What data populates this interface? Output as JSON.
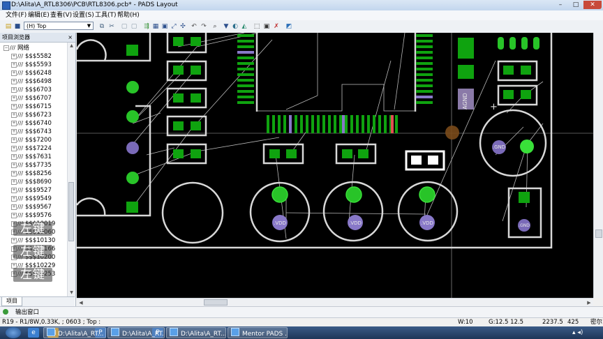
{
  "window": {
    "title": "D:\\Alita\\A_RTL8306\\PCB\\RTL8306.pcb* - PADS Layout",
    "min": "–",
    "max": "□",
    "close": "✕"
  },
  "menu": [
    "文件(F)",
    "编辑(E)",
    "查看(V)",
    "设置(S)",
    "工具(T)",
    "帮助(H)"
  ],
  "toolbar": {
    "layer_select": "(H) Top",
    "icons": [
      "open-icon",
      "save-icon",
      "layer-select",
      "copy-icon",
      "cut-icon",
      "paste-icon",
      "route-icon",
      "drc-icon",
      "measure-icon",
      "undo-icon",
      "redo-icon",
      "zoom-icon",
      "filter-icon",
      "color-icon",
      "highlight-icon",
      "select-icon",
      "net-icon",
      "help-icon"
    ]
  },
  "panel": {
    "title": "项目浏览器",
    "close": "×",
    "root_label": "网络",
    "nets": [
      "$$$5582",
      "$$$5593",
      "$$$6248",
      "$$$6498",
      "$$$6703",
      "$$$6707",
      "$$$6715",
      "$$$6723",
      "$$$6740",
      "$$$6743",
      "$$$7200",
      "$$$7224",
      "$$$7631",
      "$$$7735",
      "$$$8256",
      "$$$8690",
      "$$$9527",
      "$$$9549",
      "$$$9567",
      "$$$9576",
      "$$$10019",
      "$$$10060",
      "$$$10130",
      "$$$10166",
      "$$$10200",
      "$$$10229",
      "$$$10253"
    ],
    "tab": "项目",
    "overlay_keys": [
      "左键",
      "左键",
      "左键"
    ]
  },
  "board": {
    "pad_labels": {
      "vdd": ".VDD",
      "gnd": ".GND",
      "agnd": "AGND"
    }
  },
  "output": {
    "label": "输出窗口"
  },
  "status": {
    "info": "R19 - R1/8W,0.33K, ; 0603 ; Top :",
    "width": "W:10",
    "grid": "G:12.5 12.5",
    "x": "2237.5",
    "y": "425",
    "unit": "密尔"
  },
  "taskbar": {
    "tasks": [
      "D:\\Alita\\A_RT...",
      "D:\\Alita\\A_RT...",
      "D:\\Alita\\A_RT...",
      "Mentor PADS ..."
    ]
  },
  "colors": {
    "pad_green": "#15a315",
    "pad_bright": "#39e039",
    "outline": "#d8d8d8",
    "via_purple": "#8878c8",
    "canvas": "#000000"
  }
}
